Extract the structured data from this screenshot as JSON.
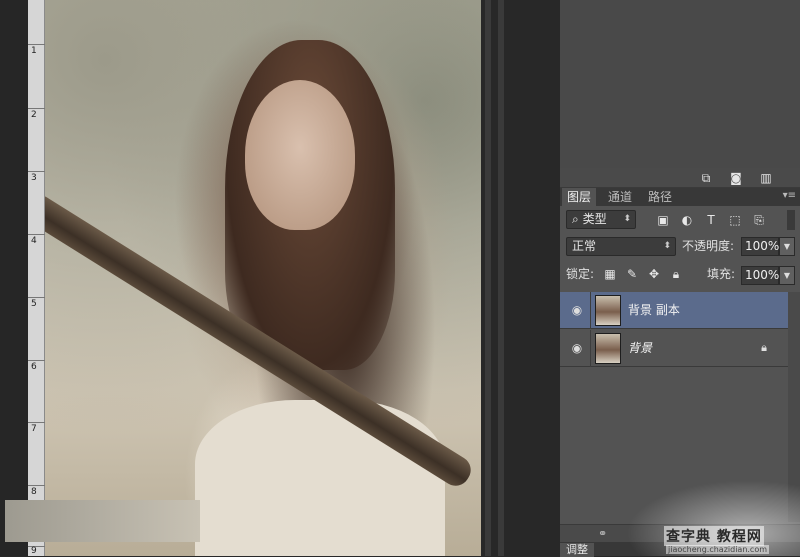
{
  "ruler": {
    "labels": [
      "1",
      "2",
      "3",
      "4",
      "5",
      "6",
      "7",
      "8",
      "9"
    ]
  },
  "layers_panel": {
    "tabs": [
      "图层",
      "通道",
      "路径"
    ],
    "filter_kind": "类型",
    "blend_mode": "正常",
    "opacity_label": "不透明度:",
    "opacity_value": "100%",
    "lock_label": "锁定:",
    "fill_label": "填充:",
    "fill_value": "100%",
    "layers": [
      {
        "name": "背景 副本",
        "selected": true,
        "visible": true,
        "locked": false
      },
      {
        "name": "背景",
        "selected": false,
        "visible": true,
        "locked": true
      }
    ]
  },
  "bottom_tab": "调整",
  "watermark": {
    "logo": "查字典 教程网",
    "url": "jiaocheng.chazidian.com"
  },
  "colors": {
    "selected_layer": "#5b6b8c",
    "panel_bg": "#535353",
    "canvas_bg": "#282828"
  },
  "icons": [
    "new-layer-icon",
    "camera-icon",
    "trash-icon",
    "search-icon",
    "image-filter-icon",
    "adjustment-filter-icon",
    "type-filter-icon",
    "shape-filter-icon",
    "smart-filter-icon",
    "lock-pixels-icon",
    "lock-brush-icon",
    "lock-move-icon",
    "lock-all-icon",
    "eye-icon",
    "lock-icon",
    "link-icon"
  ]
}
